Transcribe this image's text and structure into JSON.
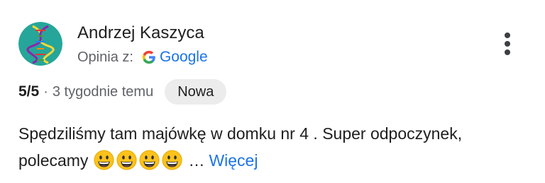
{
  "review": {
    "author_name": "Andrzej Kaszyca",
    "source_label": "Opinia z:",
    "source_name": "Google",
    "rating": "5/5",
    "separator": "·",
    "time_ago": "3 tygodnie temu",
    "badge": "Nowa",
    "text_line_1": "Spędziliśmy tam majówkę w domku nr 4 . Super odpoczynek,",
    "text_line_2": "polecamy",
    "emoji_count": 4,
    "ellipsis": "…",
    "more_label": "Więcej"
  },
  "icons": {
    "avatar": "dna-helix-avatar",
    "source": "google-g-icon",
    "menu": "more-vert-icon",
    "emoji": "grinning-face-icon"
  },
  "colors": {
    "link": "#1a73e8",
    "secondary_text": "#5f6368",
    "badge_bg": "#ececec",
    "avatar_bg": "#26a69a"
  }
}
